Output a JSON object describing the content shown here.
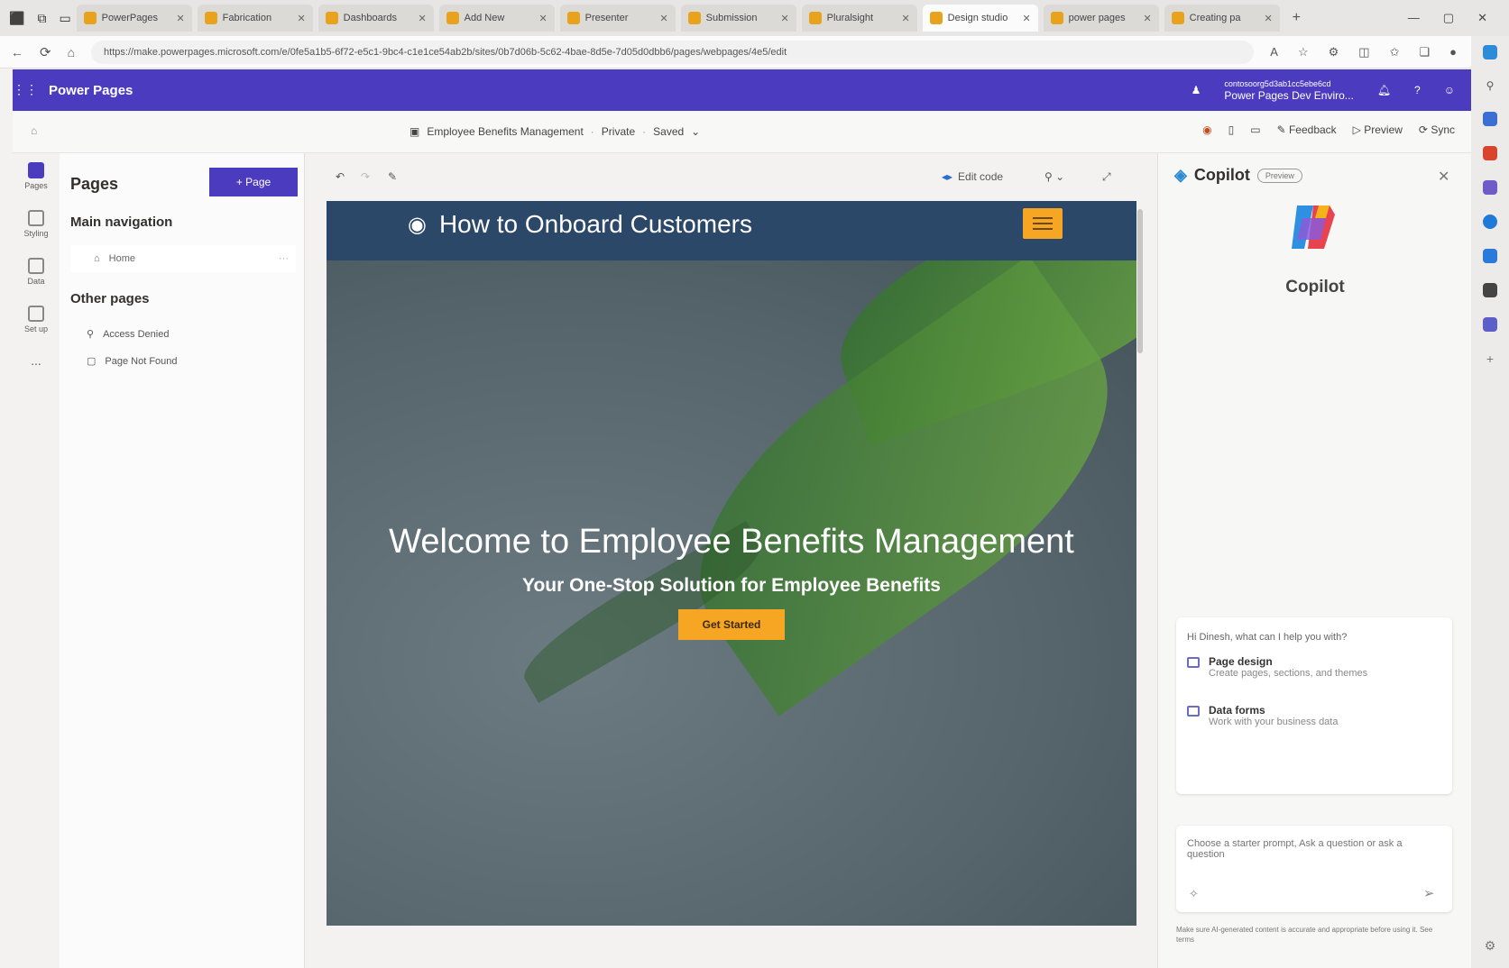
{
  "browser": {
    "tabs": [
      {
        "label": "PowerPages",
        "active": false
      },
      {
        "label": "Fabrication",
        "active": false
      },
      {
        "label": "Dashboards",
        "active": false
      },
      {
        "label": "Add New",
        "active": false
      },
      {
        "label": "Presenter",
        "active": false
      },
      {
        "label": "Submission",
        "active": false
      },
      {
        "label": "Pluralsight",
        "active": false
      },
      {
        "label": "Design studio",
        "active": true
      },
      {
        "label": "power pages",
        "active": false
      },
      {
        "label": "Creating pa",
        "active": false
      }
    ],
    "url": "https://make.powerpages.microsoft.com/e/0fe5a1b5-6f72-e5c1-9bc4-c1e1ce54ab2b/sites/0b7d06b-5c62-4bae-8d5e-7d05d0dbb6/pages/webpages/4e5/edit"
  },
  "app": {
    "title": "Power Pages",
    "environment_org": "contosoorg5d3ab1cc5ebe6cd",
    "environment_name": "Power Pages Dev Enviro..."
  },
  "command_bar": {
    "site_name": "Employee Benefits Management",
    "visibility": "Private",
    "save_status": "Saved",
    "feedback": "Feedback",
    "preview": "Preview",
    "sync": "Sync"
  },
  "rail": {
    "items": [
      {
        "label": "Pages",
        "icon": "pages-icon",
        "active": true
      },
      {
        "label": "Styling",
        "icon": "styling-icon",
        "active": false
      },
      {
        "label": "Data",
        "icon": "data-icon",
        "active": false
      },
      {
        "label": "Set up",
        "icon": "setup-icon",
        "active": false
      }
    ],
    "more": "..."
  },
  "pages_panel": {
    "title": "Pages",
    "add_button": "+ Page",
    "main_nav_title": "Main navigation",
    "home": "Home",
    "other_pages_title": "Other pages",
    "other_pages": [
      "Access Denied",
      "Page Not Found"
    ]
  },
  "canvas_toolbar": {
    "edit_code": "Edit code"
  },
  "site": {
    "brand": "How to Onboard Customers",
    "hero_title": "Welcome to Employee Benefits Management",
    "hero_subtitle": "Your One-Stop Solution for Employee Benefits",
    "cta": "Get Started"
  },
  "copilot": {
    "title": "Copilot",
    "badge": "Preview",
    "name": "Copilot",
    "greeting": "Hi Dinesh, what can I help you with?",
    "options": [
      {
        "title": "Page design",
        "desc": "Create pages, sections, and themes",
        "icon": "page-design-icon"
      },
      {
        "title": "Data forms",
        "desc": "Work with your business data",
        "icon": "data-forms-icon"
      }
    ],
    "input_placeholder": "Choose a starter prompt, Ask a question or ask a question",
    "footer": "Make sure AI-generated content is accurate and appropriate before using it. See terms"
  },
  "colors": {
    "brand": "#4b3bbf",
    "site_header": "#2c4868",
    "accent": "#f6a623"
  }
}
